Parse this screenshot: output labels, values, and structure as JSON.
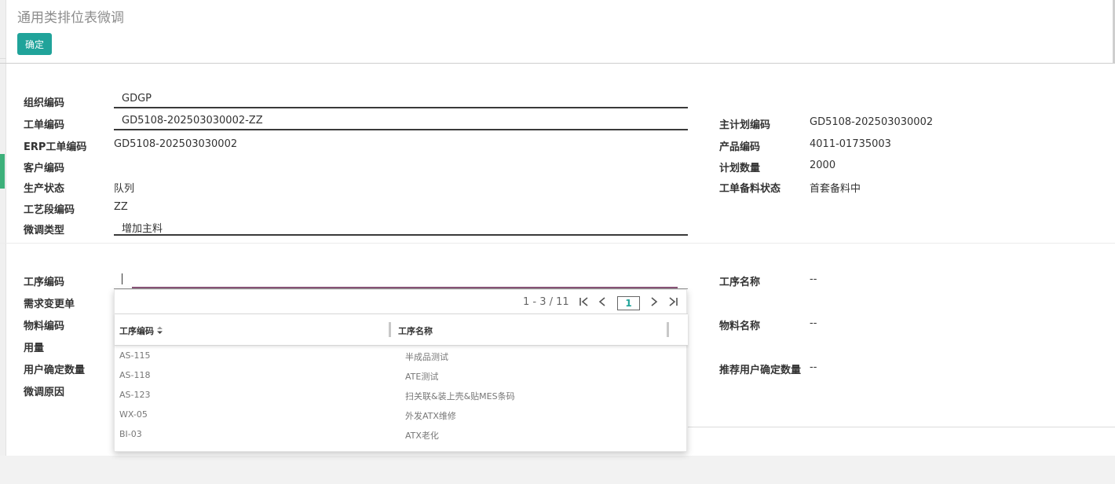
{
  "page_title": "通用类排位表微调",
  "toolbar": {
    "confirm_label": "确定"
  },
  "form": {
    "org_code": {
      "label": "组织编码",
      "value": "GDGP"
    },
    "wo_code": {
      "label": "工单编码",
      "value": "GD5108-202503030002-ZZ"
    },
    "erp_wo_code": {
      "label": "ERP工单编码",
      "value": "GD5108-202503030002"
    },
    "customer_code": {
      "label": "客户编码",
      "value": ""
    },
    "prod_status": {
      "label": "生产状态",
      "value": "队列"
    },
    "segment_code": {
      "label": "工艺段编码",
      "value": "ZZ"
    },
    "adjust_type": {
      "label": "微调类型",
      "value": "增加主料"
    },
    "master_plan_code": {
      "label": "主计划编码",
      "value": "GD5108-202503030002"
    },
    "product_code": {
      "label": "产品编码",
      "value": "4011-01735003"
    },
    "plan_qty": {
      "label": "计划数量",
      "value": "2000"
    },
    "material_status": {
      "label": "工单备料状态",
      "value": "首套备料中"
    }
  },
  "detail": {
    "op_code": {
      "label": "工序编码",
      "value": ""
    },
    "change_order": {
      "label": "需求变更单"
    },
    "material_code": {
      "label": "物料编码"
    },
    "usage": {
      "label": "用量"
    },
    "user_qty": {
      "label": "用户确定数量"
    },
    "reason": {
      "label": "微调原因"
    },
    "op_name": {
      "label": "工序名称",
      "value": "--"
    },
    "material_name": {
      "label": "物料名称",
      "value": "--"
    },
    "rec_user_qty": {
      "label": "推荐用户确定数量",
      "value": "--"
    }
  },
  "dropdown": {
    "pager_text": "1 - 3 / 11",
    "page": "1",
    "columns": [
      "工序编码",
      "工序名称"
    ],
    "rows": [
      [
        "AS-115",
        "半成品测试"
      ],
      [
        "AS-118",
        "ATE测试"
      ],
      [
        "AS-123",
        "扫关联&装上壳&贴MES条码"
      ],
      [
        "WX-05",
        "外发ATX维修"
      ],
      [
        "BI-03",
        "ATX老化"
      ]
    ]
  }
}
